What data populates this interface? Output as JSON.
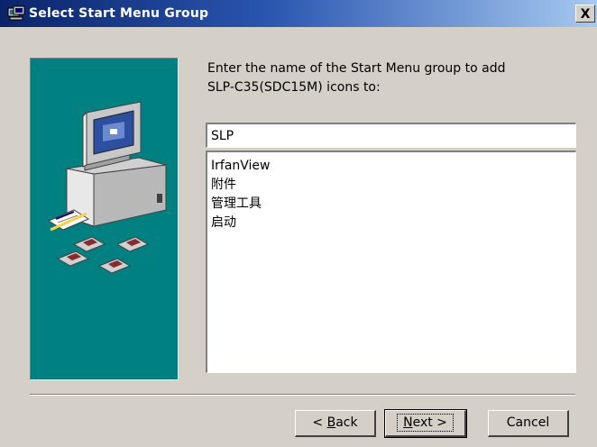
{
  "window": {
    "title": "Select Start Menu Group",
    "close_label": "X"
  },
  "prompt": {
    "line1": "Enter the name of the Start Menu group to add",
    "line2": "SLP-C35(SDC15M) icons to:"
  },
  "group_input": {
    "value": "SLP"
  },
  "group_list": {
    "items": [
      "IrfanView",
      "附件",
      "管理工具",
      "启动"
    ]
  },
  "buttons": {
    "back": {
      "prefix": "< ",
      "accel": "B",
      "rest": "ack"
    },
    "next": {
      "accel": "N",
      "rest": "ext >"
    },
    "cancel": "Cancel"
  },
  "colors": {
    "title_start": "#0a246a",
    "panel": "#008080",
    "dialog_bg": "#d4d0c8"
  }
}
